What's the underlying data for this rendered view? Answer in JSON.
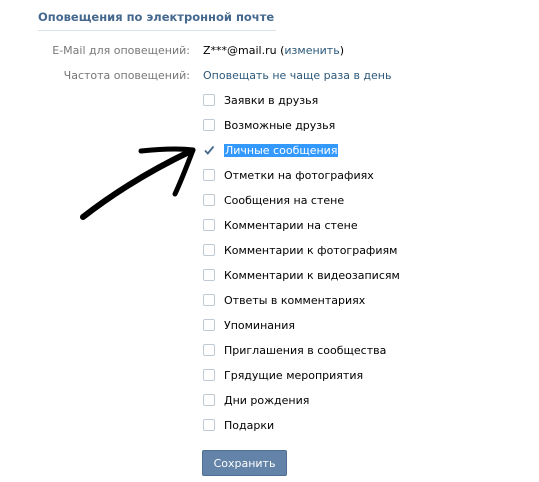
{
  "section": {
    "title": "Оповещения по электронной почте"
  },
  "email": {
    "label": "E-Mail для оповещений:",
    "value": "Z***@mail.ru",
    "change_link": "изменить",
    "open_paren": " (",
    "close_paren": ")"
  },
  "frequency": {
    "label": "Частота оповещений:",
    "value": "Оповещать не чаще раза в день"
  },
  "options": [
    {
      "label": "Заявки в друзья",
      "checked": false,
      "highlighted": false
    },
    {
      "label": "Возможные друзья",
      "checked": false,
      "highlighted": false
    },
    {
      "label": "Личные сообщения",
      "checked": true,
      "highlighted": true
    },
    {
      "label": "Отметки на фотографиях",
      "checked": false,
      "highlighted": false
    },
    {
      "label": "Сообщения на стене",
      "checked": false,
      "highlighted": false
    },
    {
      "label": "Комментарии на стене",
      "checked": false,
      "highlighted": false
    },
    {
      "label": "Комментарии к фотографиям",
      "checked": false,
      "highlighted": false
    },
    {
      "label": "Комментарии к видеозаписям",
      "checked": false,
      "highlighted": false
    },
    {
      "label": "Ответы в комментариях",
      "checked": false,
      "highlighted": false
    },
    {
      "label": "Упоминания",
      "checked": false,
      "highlighted": false
    },
    {
      "label": "Приглашения в сообщества",
      "checked": false,
      "highlighted": false
    },
    {
      "label": "Грядущие мероприятия",
      "checked": false,
      "highlighted": false
    },
    {
      "label": "Дни рождения",
      "checked": false,
      "highlighted": false
    },
    {
      "label": "Подарки",
      "checked": false,
      "highlighted": false
    }
  ],
  "save_button": {
    "label": "Сохранить"
  },
  "colors": {
    "title": "#45688e",
    "link": "#2b587a",
    "button": "#6383a8",
    "highlight": "#3399ff",
    "checkmark": "#45688e"
  },
  "annotation": {
    "icon": "hand-drawn-arrow-icon"
  }
}
